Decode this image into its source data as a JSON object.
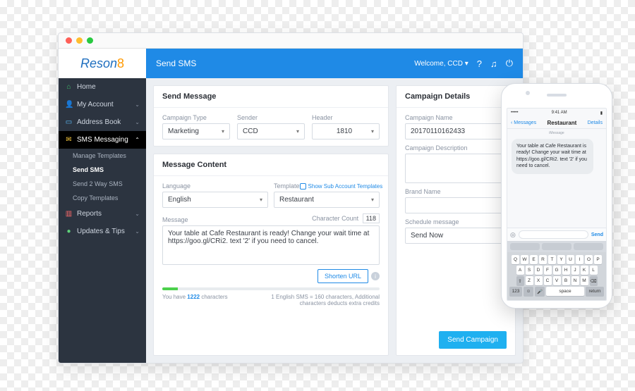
{
  "logo": {
    "base": "Reson",
    "eight": "8"
  },
  "header": {
    "title": "Send SMS",
    "welcome": "Welcome, CCD ▾"
  },
  "sidebar": {
    "home": "Home",
    "account": "My Account",
    "address": "Address Book",
    "sms": "SMS Messaging",
    "subs": {
      "manage": "Manage Templates",
      "send": "Send SMS",
      "send2": "Send 2 Way SMS",
      "copy": "Copy Templates"
    },
    "reports": "Reports",
    "updates": "Updates & Tips"
  },
  "sendMessage": {
    "title": "Send Message",
    "campaignTypeLabel": "Campaign Type",
    "campaignType": "Marketing",
    "senderLabel": "Sender",
    "sender": "CCD",
    "headerLabel": "Header",
    "header": "1810"
  },
  "messageContent": {
    "title": "Message Content",
    "languageLabel": "Language",
    "language": "English",
    "templateLabel": "Template",
    "template": "Restaurant",
    "showSub": "Show Sub Account Templates",
    "messageLabel": "Message",
    "charCountLabel": "Character Count",
    "charCount": "118",
    "message": "Your table at Cafe Restaurant is ready! Change your wait time at https://goo.gl/CRi2. text '2' if you need to cancel.",
    "shortenBtn": "Shorten URL",
    "charsLeftPrefix": "You have ",
    "charsLeft": "1222",
    "charsLeftSuffix": " characters",
    "ruleLine": "1 English SMS = 160 characters, Additional characters deducts extra credits"
  },
  "campaignDetails": {
    "title": "Campaign Details",
    "nameLabel": "Campaign Name",
    "name": "20170110162433",
    "descLabel": "Campaign Description",
    "desc": "",
    "brandLabel": "Brand Name",
    "brand": "",
    "scheduleLabel": "Schedule message",
    "schedule": "Send Now",
    "sendBtn": "Send Campaign"
  },
  "phone": {
    "time": "9:41 AM",
    "back": "Messages",
    "title": "Restaurant",
    "details": "Details",
    "metaLine": "iMessage",
    "bubble": "Your table at Cafe Restaurant is ready! Change your wait time at https://goo.gl/CRi2. text '2' if you need to cancel.",
    "send": "Send",
    "kbNum": "123",
    "kbSpace": "space",
    "kbReturn": "return"
  },
  "kb": {
    "r1": [
      "Q",
      "W",
      "E",
      "R",
      "T",
      "Y",
      "U",
      "I",
      "O",
      "P"
    ],
    "r2": [
      "A",
      "S",
      "D",
      "F",
      "G",
      "H",
      "J",
      "K",
      "L"
    ],
    "r3": [
      "Z",
      "X",
      "C",
      "V",
      "B",
      "N",
      "M"
    ]
  }
}
